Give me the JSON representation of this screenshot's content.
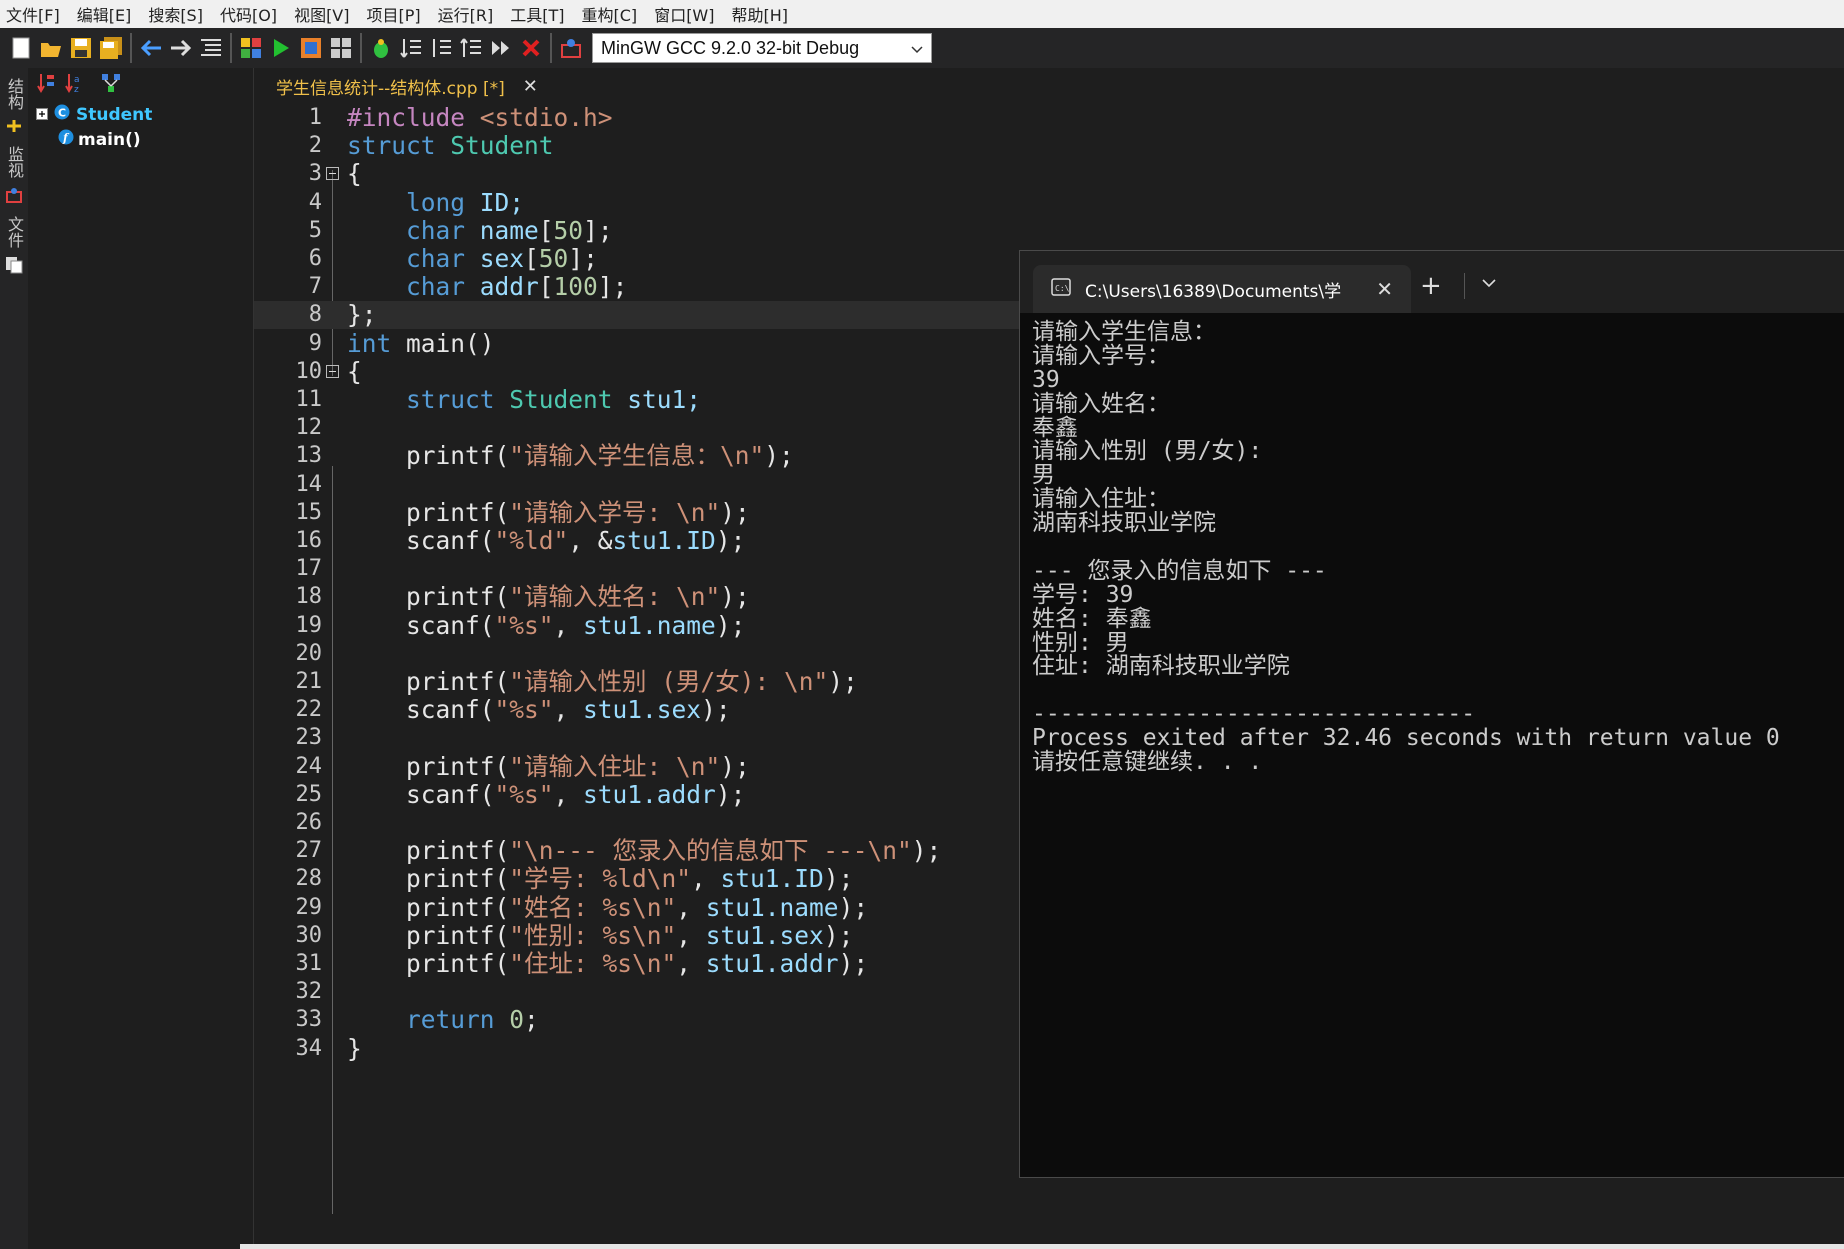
{
  "menu": [
    "文件[F]",
    "编辑[E]",
    "搜索[S]",
    "代码[O]",
    "视图[V]",
    "项目[P]",
    "运行[R]",
    "工具[T]",
    "重构[C]",
    "窗口[W]",
    "帮助[H]"
  ],
  "toolbar": {
    "compiler": "MinGW GCC 9.2.0 32-bit Debug"
  },
  "left_tabs": [
    "结构",
    "监视",
    "文件"
  ],
  "class_tree": [
    {
      "label": "Student",
      "icon": "class-icon"
    },
    {
      "label": "main()",
      "icon": "function-icon"
    }
  ],
  "editor": {
    "tab_title": "学生信息统计--结构体.cpp [*]",
    "tab_close": "✕",
    "lines": [
      {
        "n": "1",
        "tokens": [
          [
            "#include ",
            "#c586c0"
          ],
          [
            "<stdio.h>",
            "#ce9178"
          ]
        ]
      },
      {
        "n": "2",
        "tokens": [
          [
            "struct ",
            "#569cd6"
          ],
          [
            "Student",
            "#4ec9b0"
          ]
        ]
      },
      {
        "n": "3",
        "tokens": [
          [
            "{",
            "#e6e6e6"
          ]
        ]
      },
      {
        "n": "4",
        "tokens": [
          [
            "    long ",
            "#569cd6"
          ],
          [
            "ID;",
            "#9cdcfe"
          ]
        ]
      },
      {
        "n": "5",
        "tokens": [
          [
            "    char ",
            "#569cd6"
          ],
          [
            "name",
            "#9cdcfe"
          ],
          [
            "[",
            "#e6e6e6"
          ],
          [
            "50",
            "#b5cea8"
          ],
          [
            "];",
            "#e6e6e6"
          ]
        ]
      },
      {
        "n": "6",
        "tokens": [
          [
            "    char ",
            "#569cd6"
          ],
          [
            "sex",
            "#9cdcfe"
          ],
          [
            "[",
            "#e6e6e6"
          ],
          [
            "50",
            "#b5cea8"
          ],
          [
            "];",
            "#e6e6e6"
          ]
        ]
      },
      {
        "n": "7",
        "tokens": [
          [
            "    char ",
            "#569cd6"
          ],
          [
            "addr",
            "#9cdcfe"
          ],
          [
            "[",
            "#e6e6e6"
          ],
          [
            "100",
            "#b5cea8"
          ],
          [
            "];",
            "#e6e6e6"
          ]
        ]
      },
      {
        "n": "8",
        "tokens": [
          [
            "};",
            "#e6e6e6"
          ]
        ]
      },
      {
        "n": "9",
        "tokens": [
          [
            "int ",
            "#569cd6"
          ],
          [
            "main()",
            "#e6e6e6"
          ]
        ]
      },
      {
        "n": "10",
        "tokens": [
          [
            "{",
            "#e6e6e6"
          ]
        ]
      },
      {
        "n": "11",
        "tokens": [
          [
            "    struct ",
            "#569cd6"
          ],
          [
            "Student ",
            "#4ec9b0"
          ],
          [
            "stu1;",
            "#9cdcfe"
          ]
        ]
      },
      {
        "n": "12",
        "tokens": []
      },
      {
        "n": "13",
        "tokens": [
          [
            "    printf(",
            "#e6e6e6"
          ],
          [
            "\"请输入学生信息：\\n\"",
            "#ce9178"
          ],
          [
            ");",
            "#e6e6e6"
          ]
        ]
      },
      {
        "n": "14",
        "tokens": []
      },
      {
        "n": "15",
        "tokens": [
          [
            "    printf(",
            "#e6e6e6"
          ],
          [
            "\"请输入学号: \\n\"",
            "#ce9178"
          ],
          [
            ");",
            "#e6e6e6"
          ]
        ]
      },
      {
        "n": "16",
        "tokens": [
          [
            "    scanf(",
            "#e6e6e6"
          ],
          [
            "\"%ld\"",
            "#ce9178"
          ],
          [
            ", &",
            "#e6e6e6"
          ],
          [
            "stu1.ID",
            "#9cdcfe"
          ],
          [
            ");",
            "#e6e6e6"
          ]
        ]
      },
      {
        "n": "17",
        "tokens": []
      },
      {
        "n": "18",
        "tokens": [
          [
            "    printf(",
            "#e6e6e6"
          ],
          [
            "\"请输入姓名: \\n\"",
            "#ce9178"
          ],
          [
            ");",
            "#e6e6e6"
          ]
        ]
      },
      {
        "n": "19",
        "tokens": [
          [
            "    scanf(",
            "#e6e6e6"
          ],
          [
            "\"%s\"",
            "#ce9178"
          ],
          [
            ", ",
            "#e6e6e6"
          ],
          [
            "stu1.name",
            "#9cdcfe"
          ],
          [
            ");",
            "#e6e6e6"
          ]
        ]
      },
      {
        "n": "20",
        "tokens": []
      },
      {
        "n": "21",
        "tokens": [
          [
            "    printf(",
            "#e6e6e6"
          ],
          [
            "\"请输入性别 (男/女): \\n\"",
            "#ce9178"
          ],
          [
            ");",
            "#e6e6e6"
          ]
        ]
      },
      {
        "n": "22",
        "tokens": [
          [
            "    scanf(",
            "#e6e6e6"
          ],
          [
            "\"%s\"",
            "#ce9178"
          ],
          [
            ", ",
            "#e6e6e6"
          ],
          [
            "stu1.sex",
            "#9cdcfe"
          ],
          [
            ");",
            "#e6e6e6"
          ]
        ]
      },
      {
        "n": "23",
        "tokens": []
      },
      {
        "n": "24",
        "tokens": [
          [
            "    printf(",
            "#e6e6e6"
          ],
          [
            "\"请输入住址: \\n\"",
            "#ce9178"
          ],
          [
            ");",
            "#e6e6e6"
          ]
        ]
      },
      {
        "n": "25",
        "tokens": [
          [
            "    scanf(",
            "#e6e6e6"
          ],
          [
            "\"%s\"",
            "#ce9178"
          ],
          [
            ", ",
            "#e6e6e6"
          ],
          [
            "stu1.addr",
            "#9cdcfe"
          ],
          [
            ");",
            "#e6e6e6"
          ]
        ]
      },
      {
        "n": "26",
        "tokens": []
      },
      {
        "n": "27",
        "tokens": [
          [
            "    printf(",
            "#e6e6e6"
          ],
          [
            "\"\\n--- 您录入的信息如下 ---\\n\"",
            "#ce9178"
          ],
          [
            ");",
            "#e6e6e6"
          ]
        ]
      },
      {
        "n": "28",
        "tokens": [
          [
            "    printf(",
            "#e6e6e6"
          ],
          [
            "\"学号: %ld\\n\"",
            "#ce9178"
          ],
          [
            ", ",
            "#e6e6e6"
          ],
          [
            "stu1.ID",
            "#9cdcfe"
          ],
          [
            ");",
            "#e6e6e6"
          ]
        ]
      },
      {
        "n": "29",
        "tokens": [
          [
            "    printf(",
            "#e6e6e6"
          ],
          [
            "\"姓名: %s\\n\"",
            "#ce9178"
          ],
          [
            ", ",
            "#e6e6e6"
          ],
          [
            "stu1.name",
            "#9cdcfe"
          ],
          [
            ");",
            "#e6e6e6"
          ]
        ]
      },
      {
        "n": "30",
        "tokens": [
          [
            "    printf(",
            "#e6e6e6"
          ],
          [
            "\"性别: %s\\n\"",
            "#ce9178"
          ],
          [
            ", ",
            "#e6e6e6"
          ],
          [
            "stu1.sex",
            "#9cdcfe"
          ],
          [
            ");",
            "#e6e6e6"
          ]
        ]
      },
      {
        "n": "31",
        "tokens": [
          [
            "    printf(",
            "#e6e6e6"
          ],
          [
            "\"住址: %s\\n\"",
            "#ce9178"
          ],
          [
            ", ",
            "#e6e6e6"
          ],
          [
            "stu1.addr",
            "#9cdcfe"
          ],
          [
            ");",
            "#e6e6e6"
          ]
        ]
      },
      {
        "n": "32",
        "tokens": []
      },
      {
        "n": "33",
        "tokens": [
          [
            "    return ",
            "#569cd6"
          ],
          [
            "0",
            "#b5cea8"
          ],
          [
            ";",
            "#e6e6e6"
          ]
        ]
      },
      {
        "n": "34",
        "tokens": [
          [
            "}",
            "#e6e6e6"
          ]
        ]
      }
    ]
  },
  "console": {
    "tab_title": "C:\\Users\\16389\\Documents\\学",
    "tab_close": "✕",
    "new_tab": "+",
    "dropdown": "⌄",
    "lines": [
      "请输入学生信息：",
      "请输入学号：",
      "39",
      "请输入姓名：",
      "奉鑫",
      "请输入性别 (男/女):",
      "男",
      "请输入住址：",
      "湖南科技职业学院",
      "",
      "--- 您录入的信息如下 ---",
      "学号: 39",
      "姓名: 奉鑫",
      "性别: 男",
      "住址: 湖南科技职业学院",
      "",
      "--------------------------------",
      "Process exited after 32.46 seconds with return value 0",
      "请按任意键继续. . ."
    ]
  }
}
